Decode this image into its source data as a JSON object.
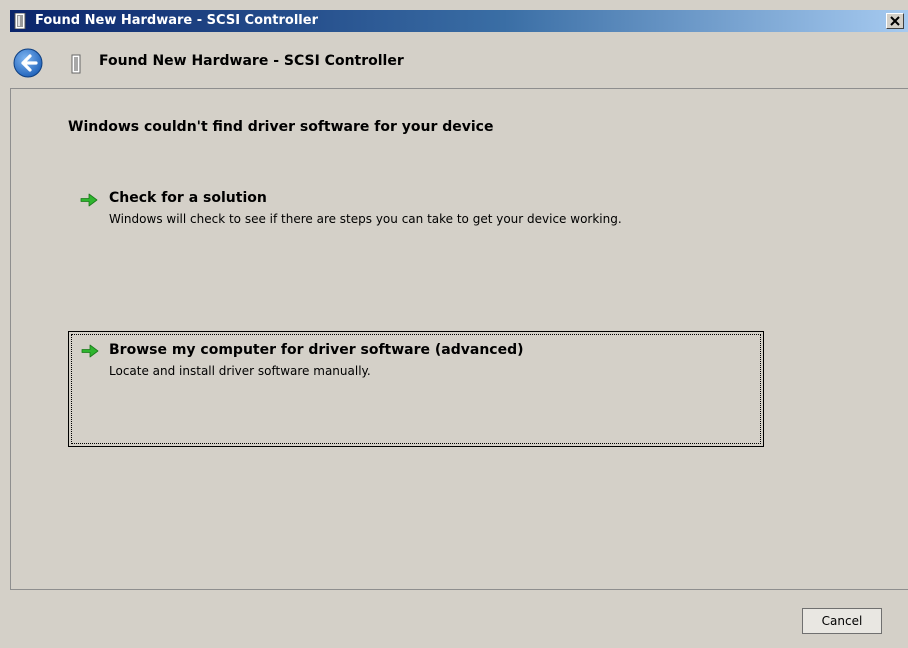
{
  "window": {
    "title": "Found New Hardware - SCSI Controller"
  },
  "header": {
    "title": "Found New Hardware - SCSI Controller"
  },
  "content": {
    "heading": "Windows couldn't find driver software for your device",
    "options": [
      {
        "title": "Check for a solution",
        "description": "Windows will check to see if there are steps you can take to get your device working."
      },
      {
        "title": "Browse my computer for driver software (advanced)",
        "description": "Locate and install driver software manually."
      }
    ]
  },
  "footer": {
    "cancel_label": "Cancel"
  },
  "icons": {
    "title": "device-icon",
    "back": "back-arrow-icon",
    "option": "green-arrow-icon",
    "close": "close-icon"
  },
  "colors": {
    "title_bar_start": "#0a246a",
    "title_bar_end": "#a6caf0",
    "dialog_background": "#d4d0c8",
    "option_arrow": "#2fb52f",
    "back_button": "#1c5fb8"
  }
}
